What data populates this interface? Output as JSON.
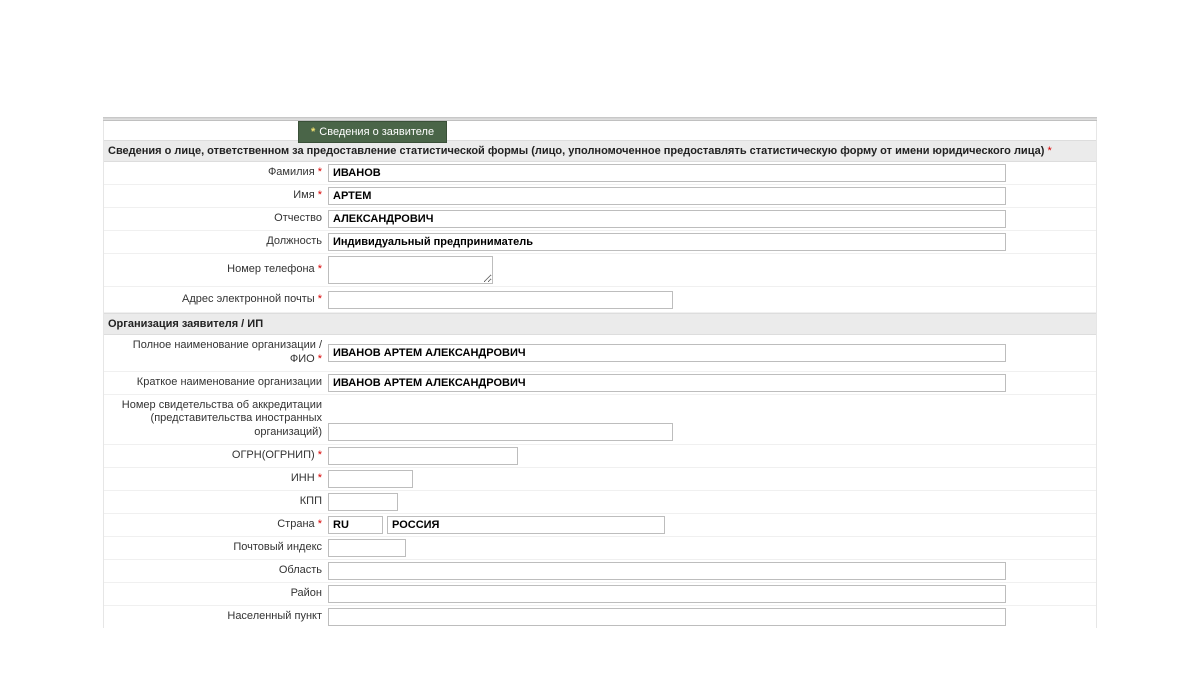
{
  "tab": {
    "label": "Сведения о заявителе"
  },
  "section1": {
    "title": "Сведения о лице, ответственном за предоставление статистической формы (лицо, уполномоченное предоставлять статистическую форму от имени юридического лица)"
  },
  "labels": {
    "surname": "Фамилия",
    "name": "Имя",
    "patronymic": "Отчество",
    "position": "Должность",
    "phone": "Номер телефона",
    "email": "Адрес электронной почты"
  },
  "values": {
    "surname": "ИВАНОВ",
    "name": "АРТЕМ",
    "patronymic": "АЛЕКСАНДРОВИЧ",
    "position": "Индивидуальный предприниматель",
    "phone": "",
    "email": ""
  },
  "section2": {
    "title": "Организация заявителя / ИП"
  },
  "org_labels": {
    "full_name": "Полное наименование организации / ФИО",
    "short_name": "Краткое наименование организации",
    "accreditation": "Номер свидетельства об аккредитации (представительства иностранных организаций)",
    "ogrn": "ОГРН(ОГРНИП)",
    "inn": "ИНН",
    "kpp": "КПП",
    "country": "Страна",
    "postcode": "Почтовый индекс",
    "region": "Область",
    "district": "Район",
    "city": "Населенный пункт"
  },
  "org_values": {
    "full_name": "ИВАНОВ АРТЕМ АЛЕКСАНДРОВИЧ",
    "short_name": "ИВАНОВ АРТЕМ АЛЕКСАНДРОВИЧ",
    "accreditation": "",
    "ogrn": "",
    "inn": "",
    "kpp": "",
    "country_code": "RU",
    "country_name": "РОССИЯ",
    "postcode": "",
    "region": "",
    "district": "",
    "city": ""
  }
}
